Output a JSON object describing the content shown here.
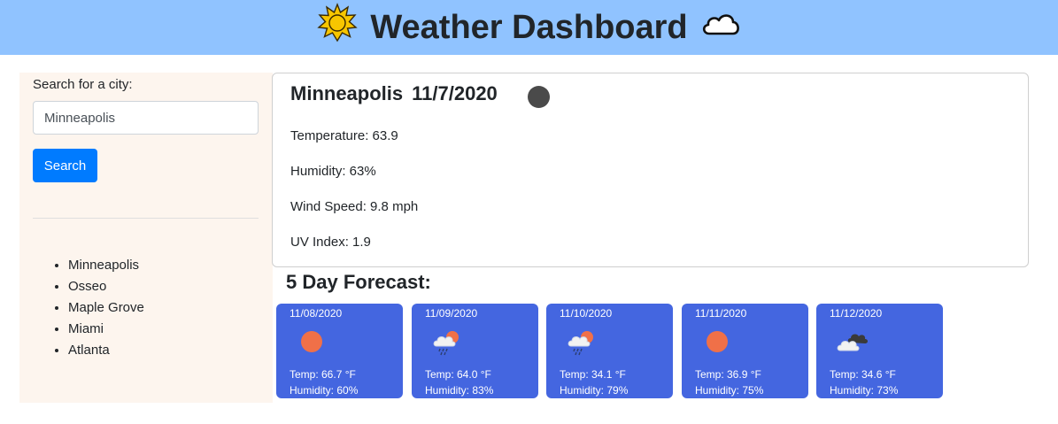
{
  "header": {
    "title": "Weather Dashboard",
    "left_icon": "sun-icon",
    "right_icon": "cloud-icon"
  },
  "search": {
    "label": "Search for a city:",
    "value": "Minneapolis",
    "button_label": "Search"
  },
  "history": [
    "Minneapolis",
    "Osseo",
    "Maple Grove",
    "Miami",
    "Atlanta"
  ],
  "current": {
    "city": "Minneapolis",
    "date": "11/7/2020",
    "icon": "weather-icon",
    "temperature": "Temperature: 63.9",
    "humidity": "Humidity: 63%",
    "wind": "Wind Speed: 9.8 mph",
    "uv": "UV Index: 1.9"
  },
  "forecast": {
    "heading": "5 Day Forecast:",
    "days": [
      {
        "date": "11/08/2020",
        "icon": "sun-icon",
        "temp": "Temp: 66.7 °F",
        "humidity": "Humidity: 60%"
      },
      {
        "date": "11/09/2020",
        "icon": "rain-icon",
        "temp": "Temp: 64.0 °F",
        "humidity": "Humidity: 83%"
      },
      {
        "date": "11/10/2020",
        "icon": "rain-icon",
        "temp": "Temp: 34.1 °F",
        "humidity": "Humidity: 79%"
      },
      {
        "date": "11/11/2020",
        "icon": "sun-icon",
        "temp": "Temp: 36.9 °F",
        "humidity": "Humidity: 75%"
      },
      {
        "date": "11/12/2020",
        "icon": "clouds-icon",
        "temp": "Temp: 34.6 °F",
        "humidity": "Humidity: 73%"
      }
    ]
  },
  "colors": {
    "header_bg": "#90c3ff",
    "sidebar_bg": "#fdf5ee",
    "button": "#007bff",
    "forecast_card": "#4466e0",
    "sun": "#f07048"
  }
}
